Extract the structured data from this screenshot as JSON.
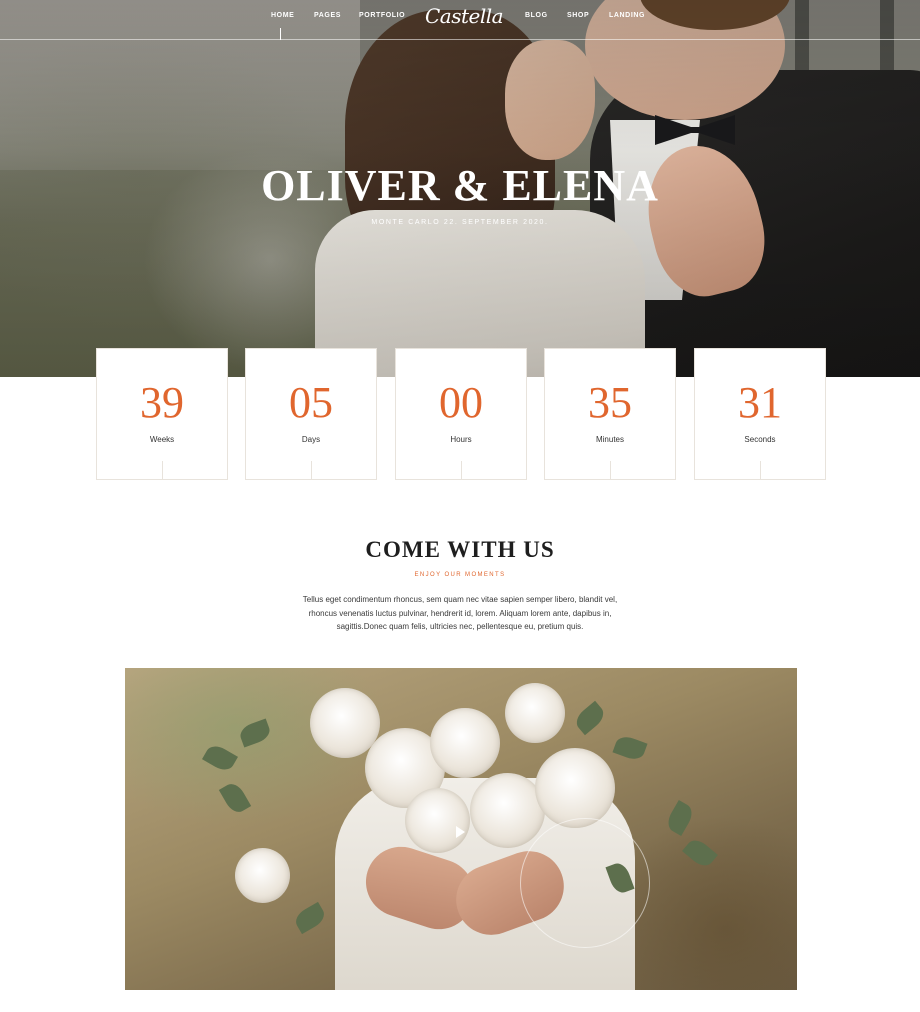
{
  "nav": {
    "logo": "Castella",
    "left_items": [
      "HOME",
      "PAGES",
      "PORTFOLIO"
    ],
    "right_items": [
      "BLOG",
      "SHOP",
      "LANDING"
    ],
    "active": "HOME"
  },
  "hero": {
    "title": "OLIVER & ELENA",
    "subtitle": "MONTE CARLO 22. SEPTEMBER 2020."
  },
  "countdown": [
    {
      "value": "39",
      "label": "Weeks"
    },
    {
      "value": "05",
      "label": "Days"
    },
    {
      "value": "00",
      "label": "Hours"
    },
    {
      "value": "35",
      "label": "Minutes"
    },
    {
      "value": "31",
      "label": "Seconds"
    }
  ],
  "section": {
    "title": "COME WITH US",
    "subtitle": "ENJOY OUR MOMENTS",
    "body": "Tellus eget condimentum rhoncus, sem quam nec vitae sapien semper libero, blandit vel, rhoncus venenatis luctus pulvinar, hendrerit id, lorem. Aliquam lorem ante, dapibus in, sagittis.Donec quam felis, ultricies nec, pellentesque eu, pretium quis."
  },
  "video": {
    "icon": "play-icon"
  },
  "colors": {
    "accent": "#e0662e",
    "box_border": "#e8e3dc",
    "text_dark": "#1e1e1e"
  }
}
